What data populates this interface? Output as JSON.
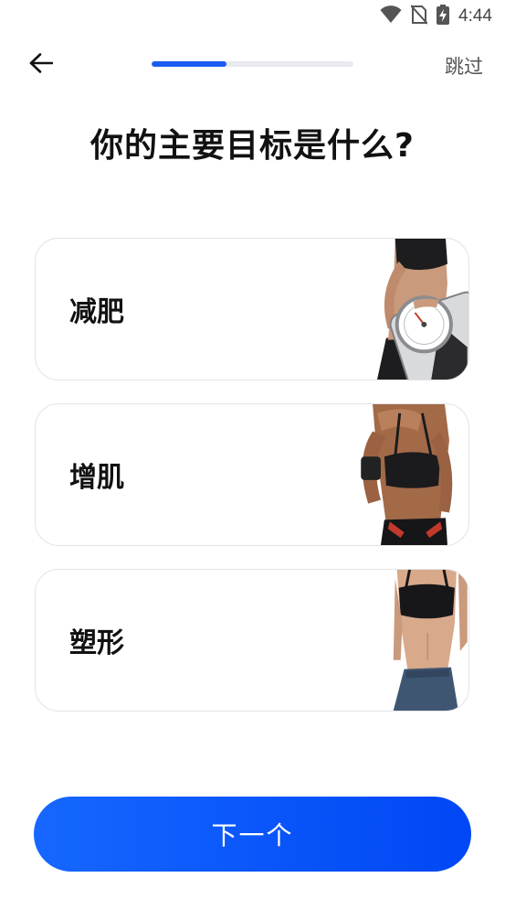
{
  "status_bar": {
    "time": "4:44",
    "icons": [
      "wifi-icon",
      "no-sim-icon",
      "battery-charging-icon"
    ]
  },
  "header": {
    "back_icon": "arrow-left-icon",
    "progress": 0.37,
    "skip_label": "跳过"
  },
  "title": "你的主要目标是什么?",
  "options": [
    {
      "label": "减肥",
      "image": "weight-loss-photo"
    },
    {
      "label": "增肌",
      "image": "muscle-gain-photo"
    },
    {
      "label": "塑形",
      "image": "body-shaping-photo"
    }
  ],
  "next_label": "下一个",
  "colors": {
    "accent": "#1a5cf0",
    "button_start": "#1667ff",
    "button_end": "#0047f5"
  }
}
